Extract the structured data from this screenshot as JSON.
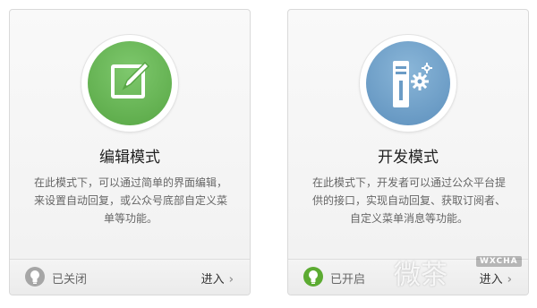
{
  "cards": [
    {
      "title": "编辑模式",
      "description": "在此模式下，可以通过简单的界面编辑，来设置自动回复，或公众号底部自定义菜单等功能。",
      "icon": "edit-icon",
      "status": "已关闭",
      "status_icon": "bulb-off-icon",
      "enter_label": "进入",
      "accent": "#62b04f"
    },
    {
      "title": "开发模式",
      "description": "在此模式下，开发者可以通过公众平台提供的接口，实现自动回复、获取订阅者、自定义菜单消息等功能。",
      "icon": "server-gear-icon",
      "status": "已开启",
      "status_icon": "bulb-on-icon",
      "enter_label": "进入",
      "accent": "#6b9cc6"
    }
  ],
  "watermark": {
    "text": "微茶",
    "badge": "WXCHA"
  }
}
